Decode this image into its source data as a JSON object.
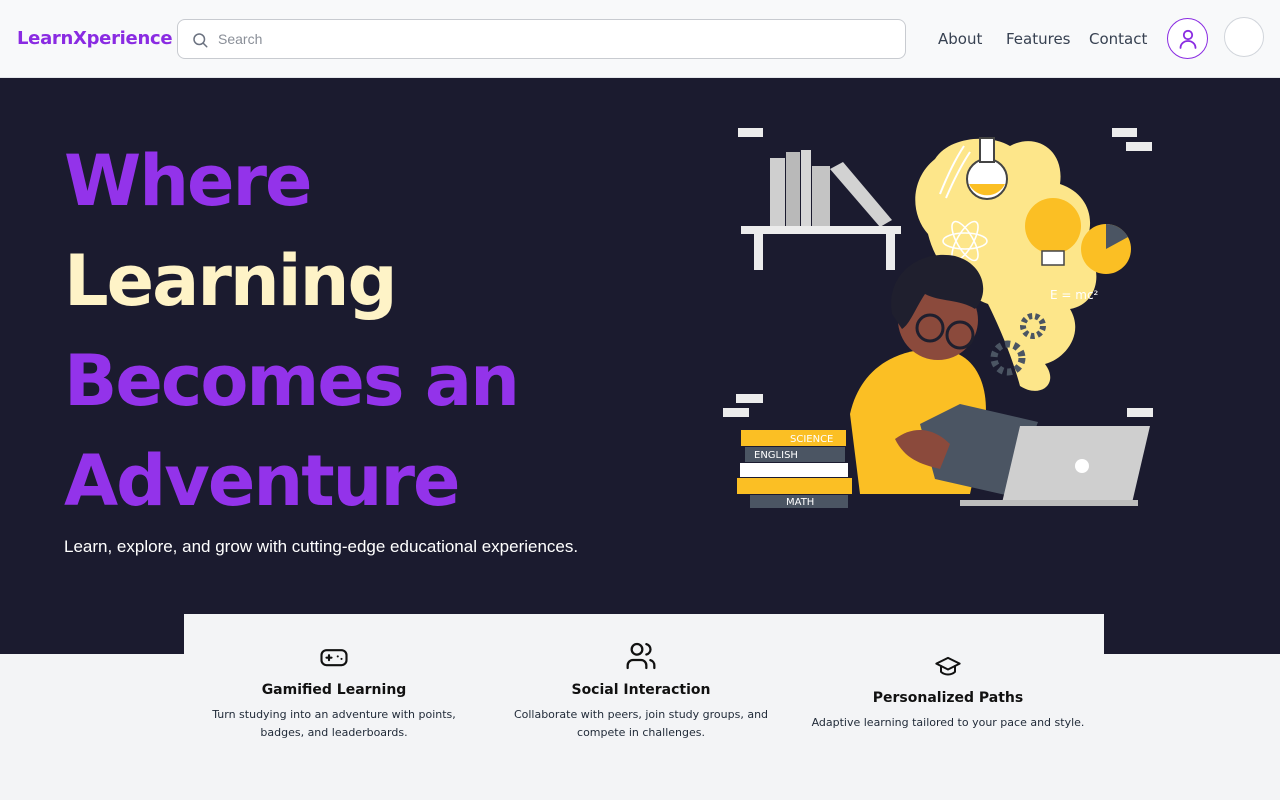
{
  "header": {
    "logo": "LearnXperience",
    "search_placeholder": "Search",
    "nav": [
      "About",
      "Features",
      "Contact"
    ]
  },
  "hero": {
    "title_lines": [
      "Where",
      "Learning",
      "Becomes an",
      "Adventure"
    ],
    "subtitle": "Learn, explore, and grow with cutting-edge educational experiences.",
    "book_labels": [
      "SCIENCE",
      "ENGLISH",
      "MATH"
    ],
    "formula": "E = mc²"
  },
  "features": [
    {
      "icon": "gamepad-icon",
      "title": "Gamified Learning",
      "desc": "Turn studying into an adventure with points, badges, and leaderboards."
    },
    {
      "icon": "users-icon",
      "title": "Social Interaction",
      "desc": "Collaborate with peers, join study groups, and compete in challenges."
    },
    {
      "icon": "graduation-cap-icon",
      "title": "Personalized Paths",
      "desc": "Adaptive learning tailored to your pace and style."
    }
  ],
  "colors": {
    "brand": "#8a2be2",
    "hero_bg": "#1b1b2f",
    "accent_cream": "#fef3c7",
    "illustration_yellow": "#fcd34d"
  }
}
